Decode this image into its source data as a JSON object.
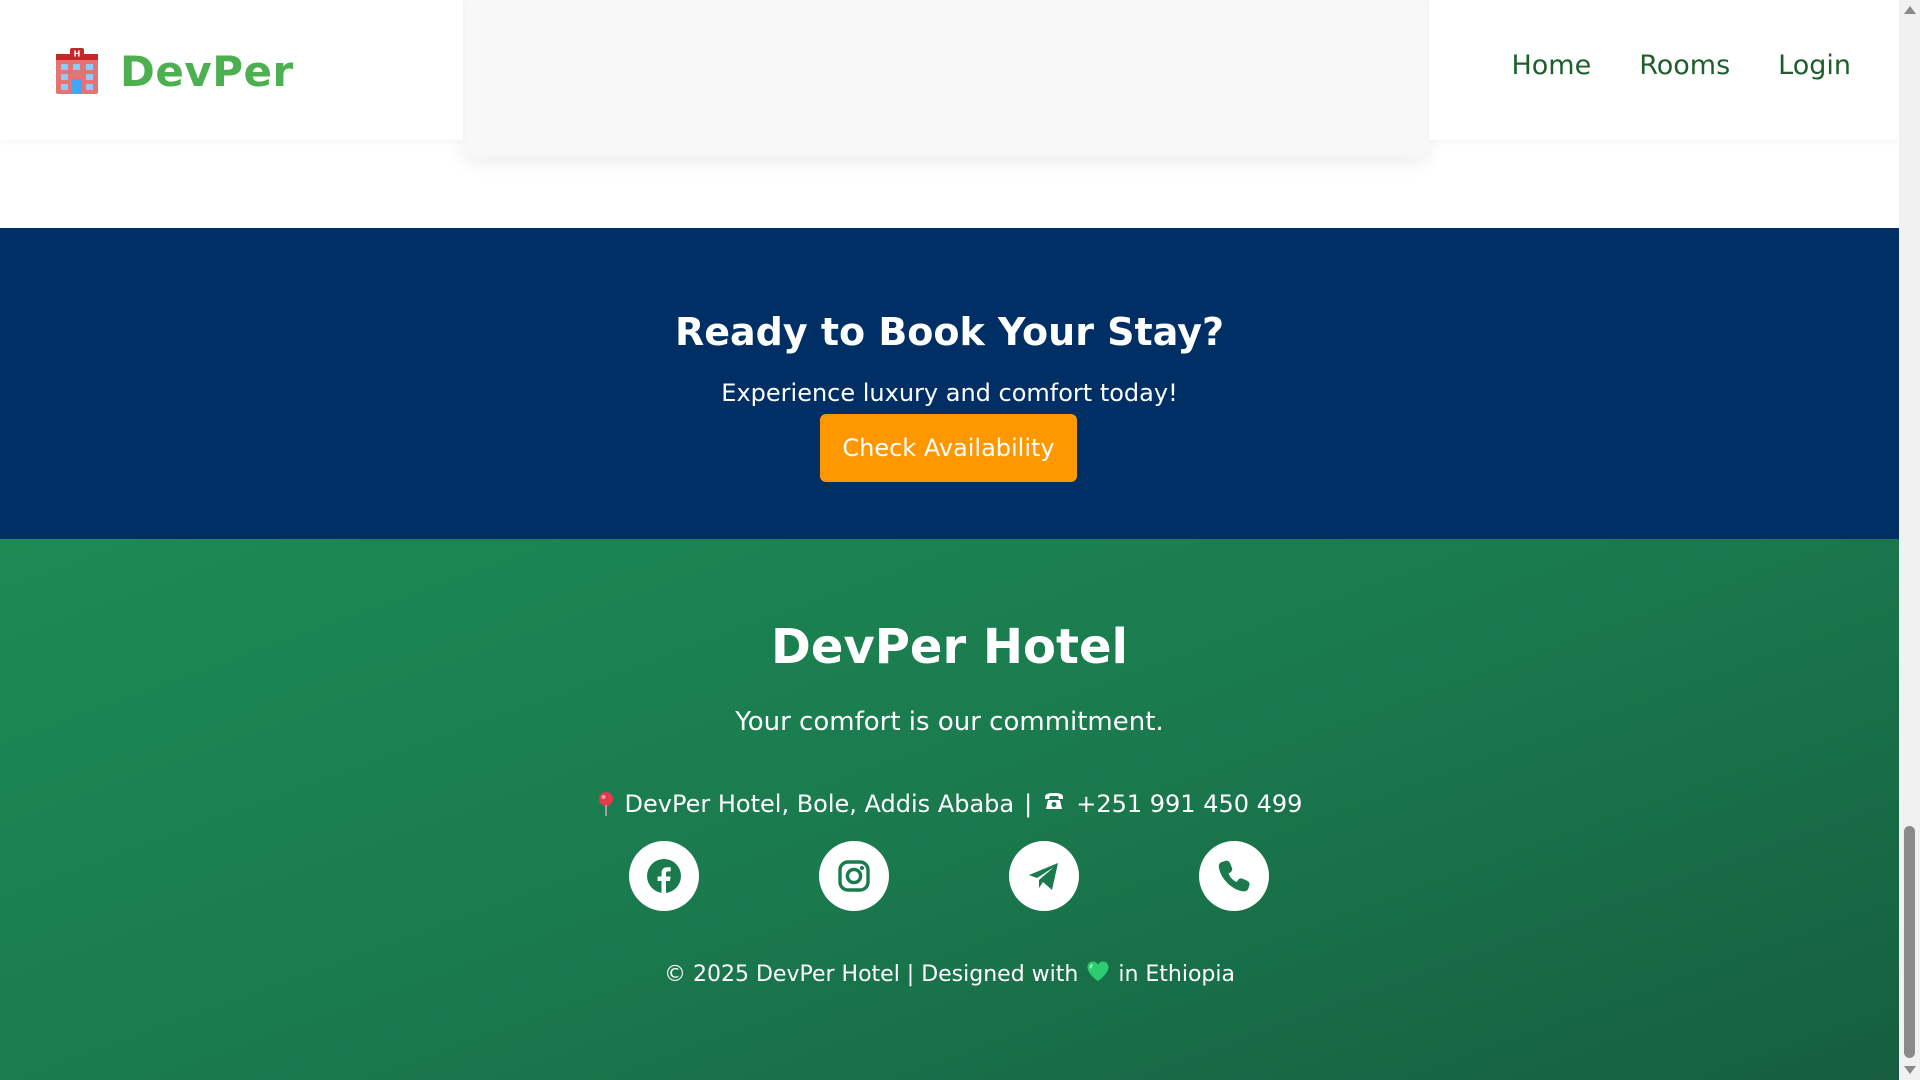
{
  "header": {
    "brand_name": "DevPer",
    "brand_icon": "hotel-icon",
    "nav": [
      {
        "label": "Home"
      },
      {
        "label": "Rooms"
      },
      {
        "label": "Login"
      }
    ]
  },
  "testimonial": {
    "blurred": true
  },
  "cta": {
    "title": "Ready to Book Your Stay?",
    "subtitle": "Experience luxury and comfort today!",
    "button_label": "Check Availability",
    "background_color": "#002f66",
    "button_color": "#ff9800"
  },
  "footer": {
    "title": "DevPer Hotel",
    "tagline": "Your comfort is our commitment.",
    "address": "DevPer Hotel, Bole, Addis Ababa",
    "separator": "|",
    "phone": "+251 991 450 499",
    "socials": [
      {
        "icon": "facebook-icon"
      },
      {
        "icon": "instagram-icon"
      },
      {
        "icon": "telegram-icon"
      },
      {
        "icon": "phone-icon"
      }
    ],
    "copyright_prefix": "© 2025 DevPer Hotel | Designed with",
    "copyright_suffix": "in Ethiopia",
    "background_color": "#1a7a4e"
  }
}
